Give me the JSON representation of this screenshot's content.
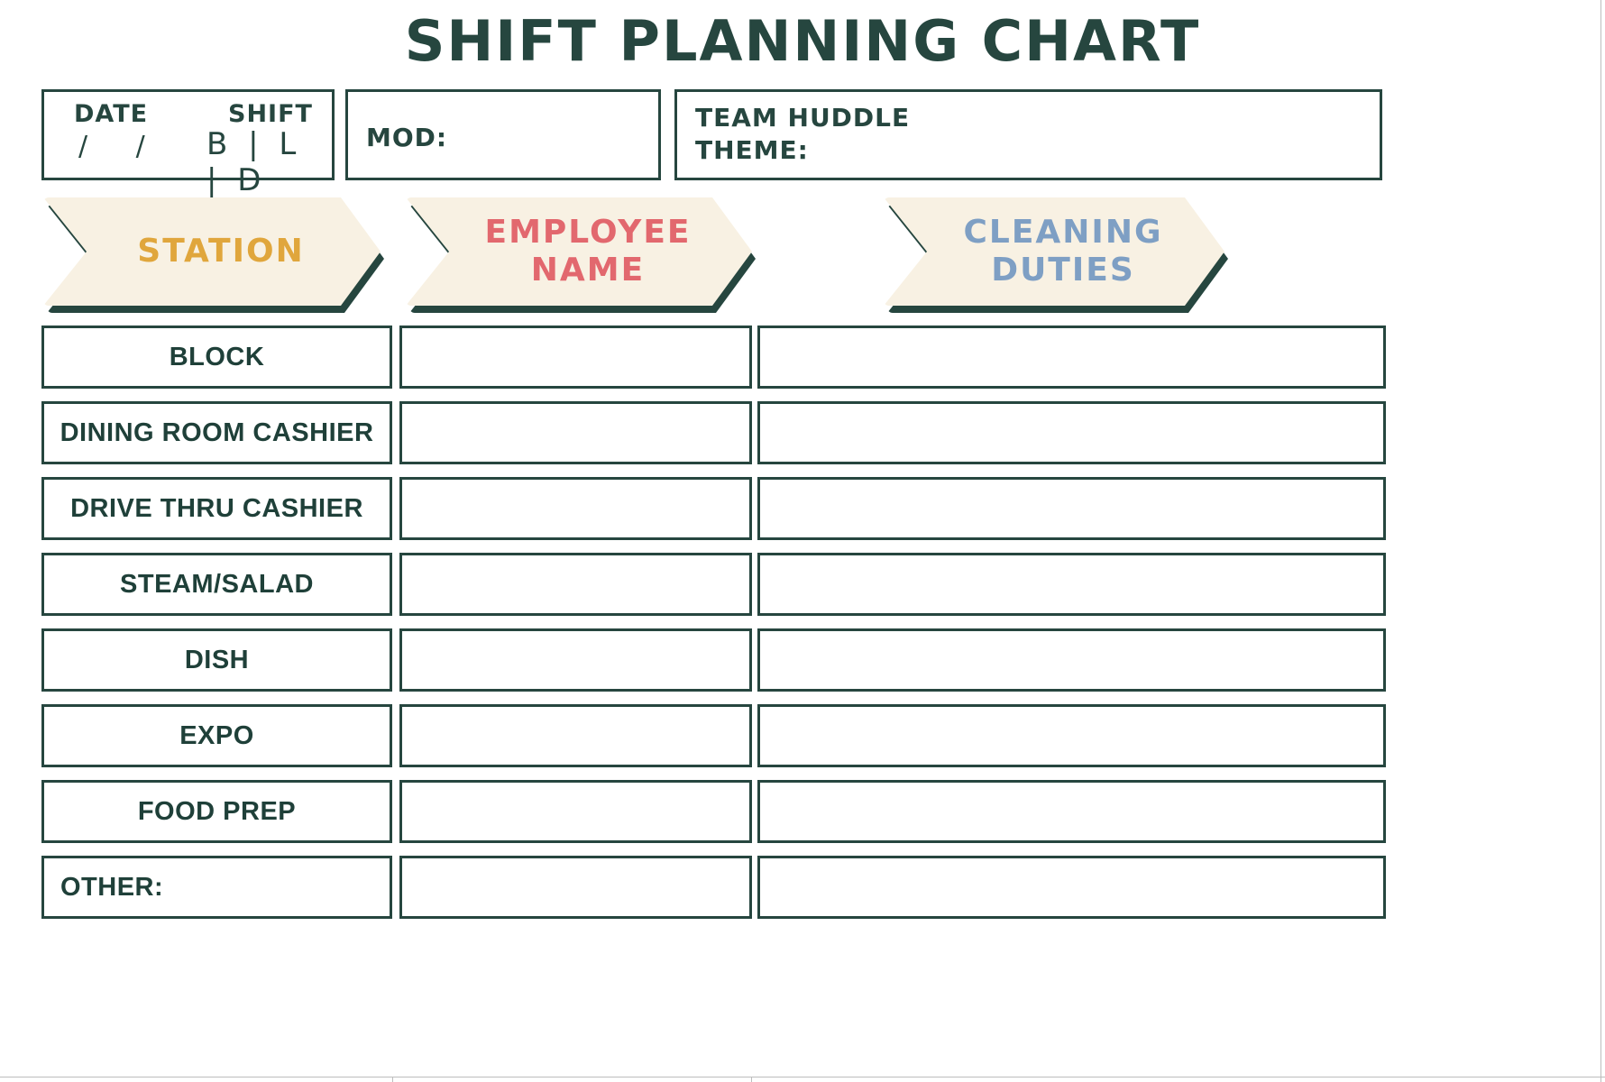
{
  "page": {
    "title": "SHIFT PLANNING CHART",
    "accent_dark": "#26463F",
    "accent_cream": "#F8F1E3",
    "accent_gold": "#E0A63C",
    "accent_coral": "#E2686E",
    "accent_blue": "#7E9FC4"
  },
  "header_fields": {
    "date_label": "DATE",
    "date_value": "/  /",
    "shift_label": "SHIFT",
    "shift_value": "B | L | D",
    "mod_label": "MOD:",
    "huddle_label_line1": "TEAM HUDDLE",
    "huddle_label_line2": "THEME:"
  },
  "columns": [
    {
      "label": "STATION",
      "color": "#E0A63C",
      "name": "station"
    },
    {
      "label": "EMPLOYEE\nNAME",
      "color": "#E2686E",
      "name": "employee-name"
    },
    {
      "label": "CLEANING\nDUTIES",
      "color": "#7E9FC4",
      "name": "cleaning-duties"
    }
  ],
  "rows": [
    {
      "station": "BLOCK",
      "employee": "",
      "duties": "",
      "align": "center"
    },
    {
      "station": "DINING ROOM CASHIER",
      "employee": "",
      "duties": "",
      "align": "center"
    },
    {
      "station": "DRIVE THRU CASHIER",
      "employee": "",
      "duties": "",
      "align": "center"
    },
    {
      "station": "STEAM/SALAD",
      "employee": "",
      "duties": "",
      "align": "center"
    },
    {
      "station": "DISH",
      "employee": "",
      "duties": "",
      "align": "center"
    },
    {
      "station": "EXPO",
      "employee": "",
      "duties": "",
      "align": "center"
    },
    {
      "station": "FOOD PREP",
      "employee": "",
      "duties": "",
      "align": "center"
    },
    {
      "station": "OTHER:",
      "employee": "",
      "duties": "",
      "align": "left"
    }
  ]
}
